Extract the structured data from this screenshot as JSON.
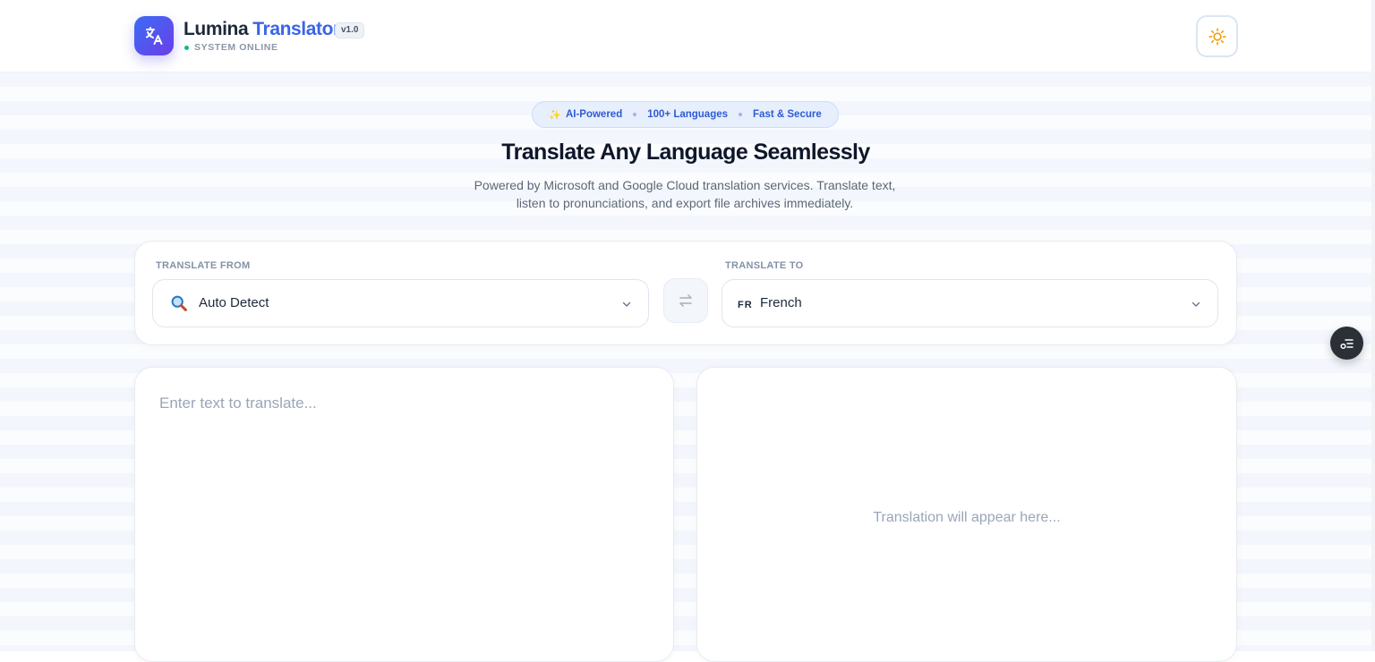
{
  "header": {
    "brand_first": "Lumina",
    "brand_second": "Translator",
    "version": "v1.0",
    "status": "SYSTEM ONLINE",
    "logo_icon": "translate-icon",
    "theme_icon": "sun-icon"
  },
  "hero": {
    "badges": [
      "AI-Powered",
      "100+ Languages",
      "Fast & Secure"
    ],
    "title": "Translate Any Language Seamlessly",
    "subtitle_line1": "Powered by Microsoft and Google Cloud translation services. Translate text,",
    "subtitle_line2": "listen to pronunciations, and export file archives immediately."
  },
  "languages": {
    "from_label": "TRANSLATE FROM",
    "from_value": "Auto Detect",
    "from_icon": "magnifier-icon",
    "to_label": "TRANSLATE TO",
    "to_code": "FR",
    "to_value": "French",
    "swap_icon": "swap-arrows-icon"
  },
  "editor": {
    "input_placeholder": "Enter text to translate...",
    "input_value": "",
    "output_placeholder": "Translation will appear here..."
  },
  "colors": {
    "accent": "#3b64e8",
    "brand_gradient_start": "#3b6cf6",
    "brand_gradient_end": "#6b3ee8",
    "status_online": "#10b981",
    "sun": "#f59e0b"
  }
}
